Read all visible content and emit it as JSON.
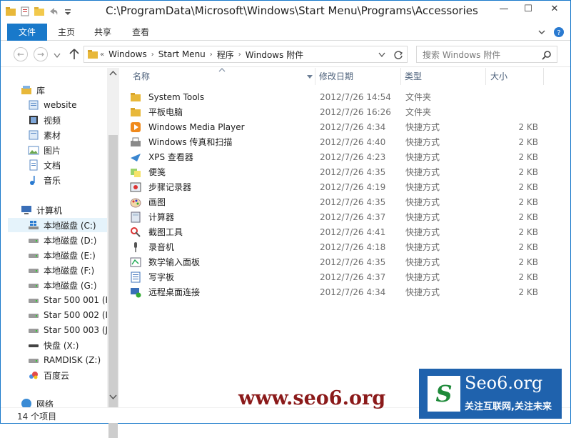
{
  "window": {
    "title": "C:\\ProgramData\\Microsoft\\Windows\\Start Menu\\Programs\\Accessories",
    "minimize": "—",
    "maximize": "☐",
    "close": "✕"
  },
  "ribbon": {
    "tabs": [
      "文件",
      "主页",
      "共享",
      "查看"
    ],
    "collapse_icon": "chevron-down-icon",
    "help_icon": "help-icon"
  },
  "address": {
    "crumbs": [
      "Windows",
      "Start Menu",
      "程序",
      "Windows 附件"
    ],
    "search_placeholder": "搜索 Windows 附件"
  },
  "nav": {
    "libraries_label": "库",
    "libraries": [
      "website",
      "视频",
      "素材",
      "图片",
      "文档",
      "音乐"
    ],
    "computer_label": "计算机",
    "drives": [
      "本地磁盘 (C:)",
      "本地磁盘 (D:)",
      "本地磁盘 (E:)",
      "本地磁盘 (F:)",
      "本地磁盘 (G:)",
      "Star 500 001 (H",
      "Star 500 002 (I:",
      "Star 500 003 (J:",
      "快盘 (X:)",
      "RAMDISK (Z:)",
      "百度云"
    ],
    "network_label": "网络"
  },
  "columns": {
    "name": "名称",
    "date": "修改日期",
    "type": "类型",
    "size": "大小"
  },
  "files": [
    {
      "name": "System Tools",
      "date": "2012/7/26 14:54",
      "type": "文件夹",
      "size": "",
      "icon": "folder-icon"
    },
    {
      "name": "平板电脑",
      "date": "2012/7/26 16:26",
      "type": "文件夹",
      "size": "",
      "icon": "folder-icon"
    },
    {
      "name": "Windows Media Player",
      "date": "2012/7/26 4:34",
      "type": "快捷方式",
      "size": "2 KB",
      "icon": "media-player-icon"
    },
    {
      "name": "Windows 传真和扫描",
      "date": "2012/7/26 4:40",
      "type": "快捷方式",
      "size": "2 KB",
      "icon": "fax-icon"
    },
    {
      "name": "XPS 查看器",
      "date": "2012/7/26 4:23",
      "type": "快捷方式",
      "size": "2 KB",
      "icon": "xps-viewer-icon"
    },
    {
      "name": "便笺",
      "date": "2012/7/26 4:35",
      "type": "快捷方式",
      "size": "2 KB",
      "icon": "sticky-notes-icon"
    },
    {
      "name": "步骤记录器",
      "date": "2012/7/26 4:19",
      "type": "快捷方式",
      "size": "2 KB",
      "icon": "steps-recorder-icon"
    },
    {
      "name": "画图",
      "date": "2012/7/26 4:35",
      "type": "快捷方式",
      "size": "2 KB",
      "icon": "paint-icon"
    },
    {
      "name": "计算器",
      "date": "2012/7/26 4:37",
      "type": "快捷方式",
      "size": "2 KB",
      "icon": "calculator-icon"
    },
    {
      "name": "截图工具",
      "date": "2012/7/26 4:41",
      "type": "快捷方式",
      "size": "2 KB",
      "icon": "snipping-tool-icon"
    },
    {
      "name": "录音机",
      "date": "2012/7/26 4:18",
      "type": "快捷方式",
      "size": "2 KB",
      "icon": "microphone-icon"
    },
    {
      "name": "数学输入面板",
      "date": "2012/7/26 4:35",
      "type": "快捷方式",
      "size": "2 KB",
      "icon": "math-input-icon"
    },
    {
      "name": "写字板",
      "date": "2012/7/26 4:37",
      "type": "快捷方式",
      "size": "2 KB",
      "icon": "wordpad-icon"
    },
    {
      "name": "远程桌面连接",
      "date": "2012/7/26 4:34",
      "type": "快捷方式",
      "size": "2 KB",
      "icon": "remote-desktop-icon"
    }
  ],
  "status": {
    "count": "14 个项目"
  },
  "watermark": {
    "url_text": "www.seo6.org",
    "logo_title": "Seo6.org",
    "logo_slogan": "关注互联网,关注未来",
    "logo_mark": "S"
  }
}
